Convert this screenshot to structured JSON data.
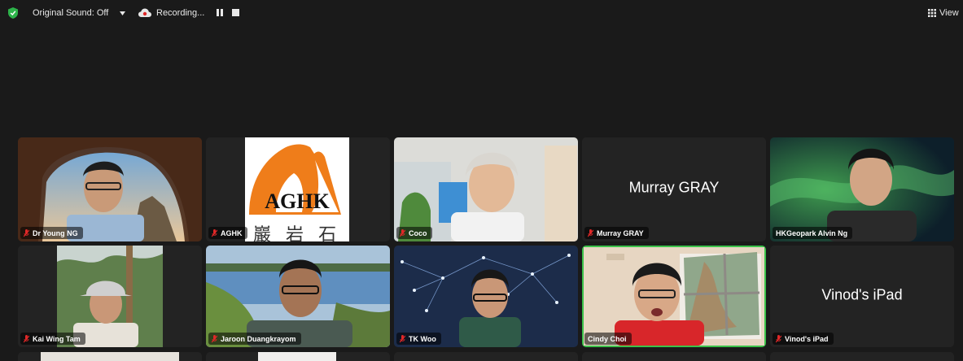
{
  "topbar": {
    "original_sound": "Original Sound: Off",
    "recording": "Recording...",
    "view": "View"
  },
  "colors": {
    "speaker_border": "#3bc24a",
    "mic_muted": "#e02828",
    "shield": "#2db34a"
  },
  "participants": [
    {
      "name": "Dr Young NG"
    },
    {
      "name": "AGHK",
      "logo_text": "AGHK",
      "logo_chars": "巖 岩 石 保"
    },
    {
      "name": "Coco"
    },
    {
      "name": "Murray GRAY",
      "center_label": "Murray GRAY"
    },
    {
      "name": "HKGeopark Alvin Ng"
    },
    {
      "name": "Kai Wing Tam"
    },
    {
      "name": "Jaroon Duangkrayom"
    },
    {
      "name": "TK Woo"
    },
    {
      "name": "Cindy Choi",
      "active_speaker": true
    },
    {
      "name": "Vinod's iPad",
      "center_label": "Vinod's iPad"
    }
  ]
}
